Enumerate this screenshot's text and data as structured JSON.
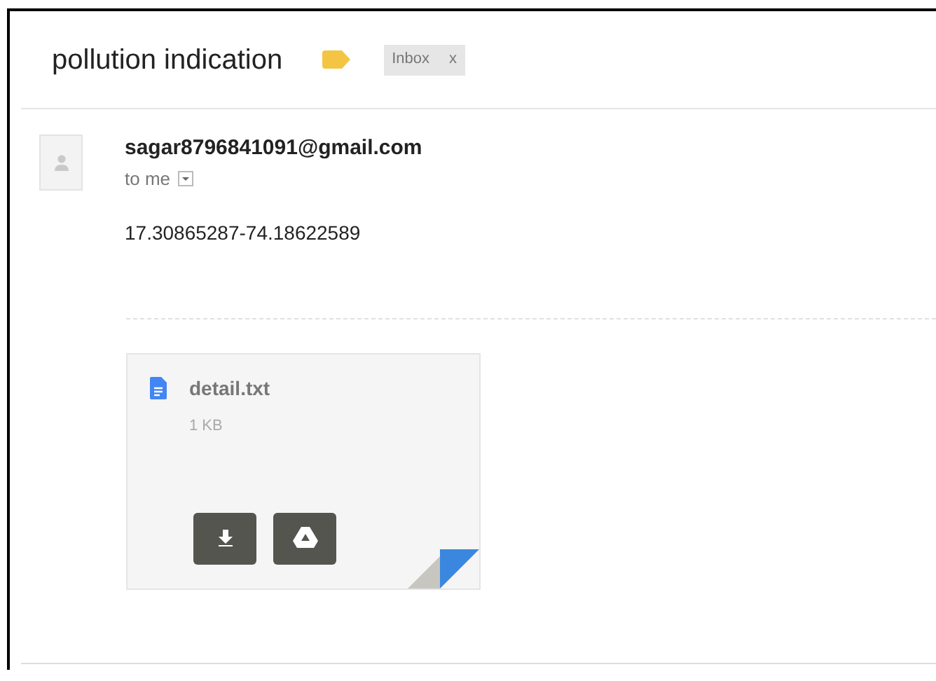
{
  "subject": "pollution indication",
  "labels": [
    {
      "text": "Inbox",
      "remove": "x"
    }
  ],
  "message": {
    "sender": "sagar8796841091@gmail.com",
    "recipient": "to me",
    "body": "17.30865287-74.18622589"
  },
  "attachments": [
    {
      "name": "detail.txt",
      "size": "1 KB"
    }
  ]
}
